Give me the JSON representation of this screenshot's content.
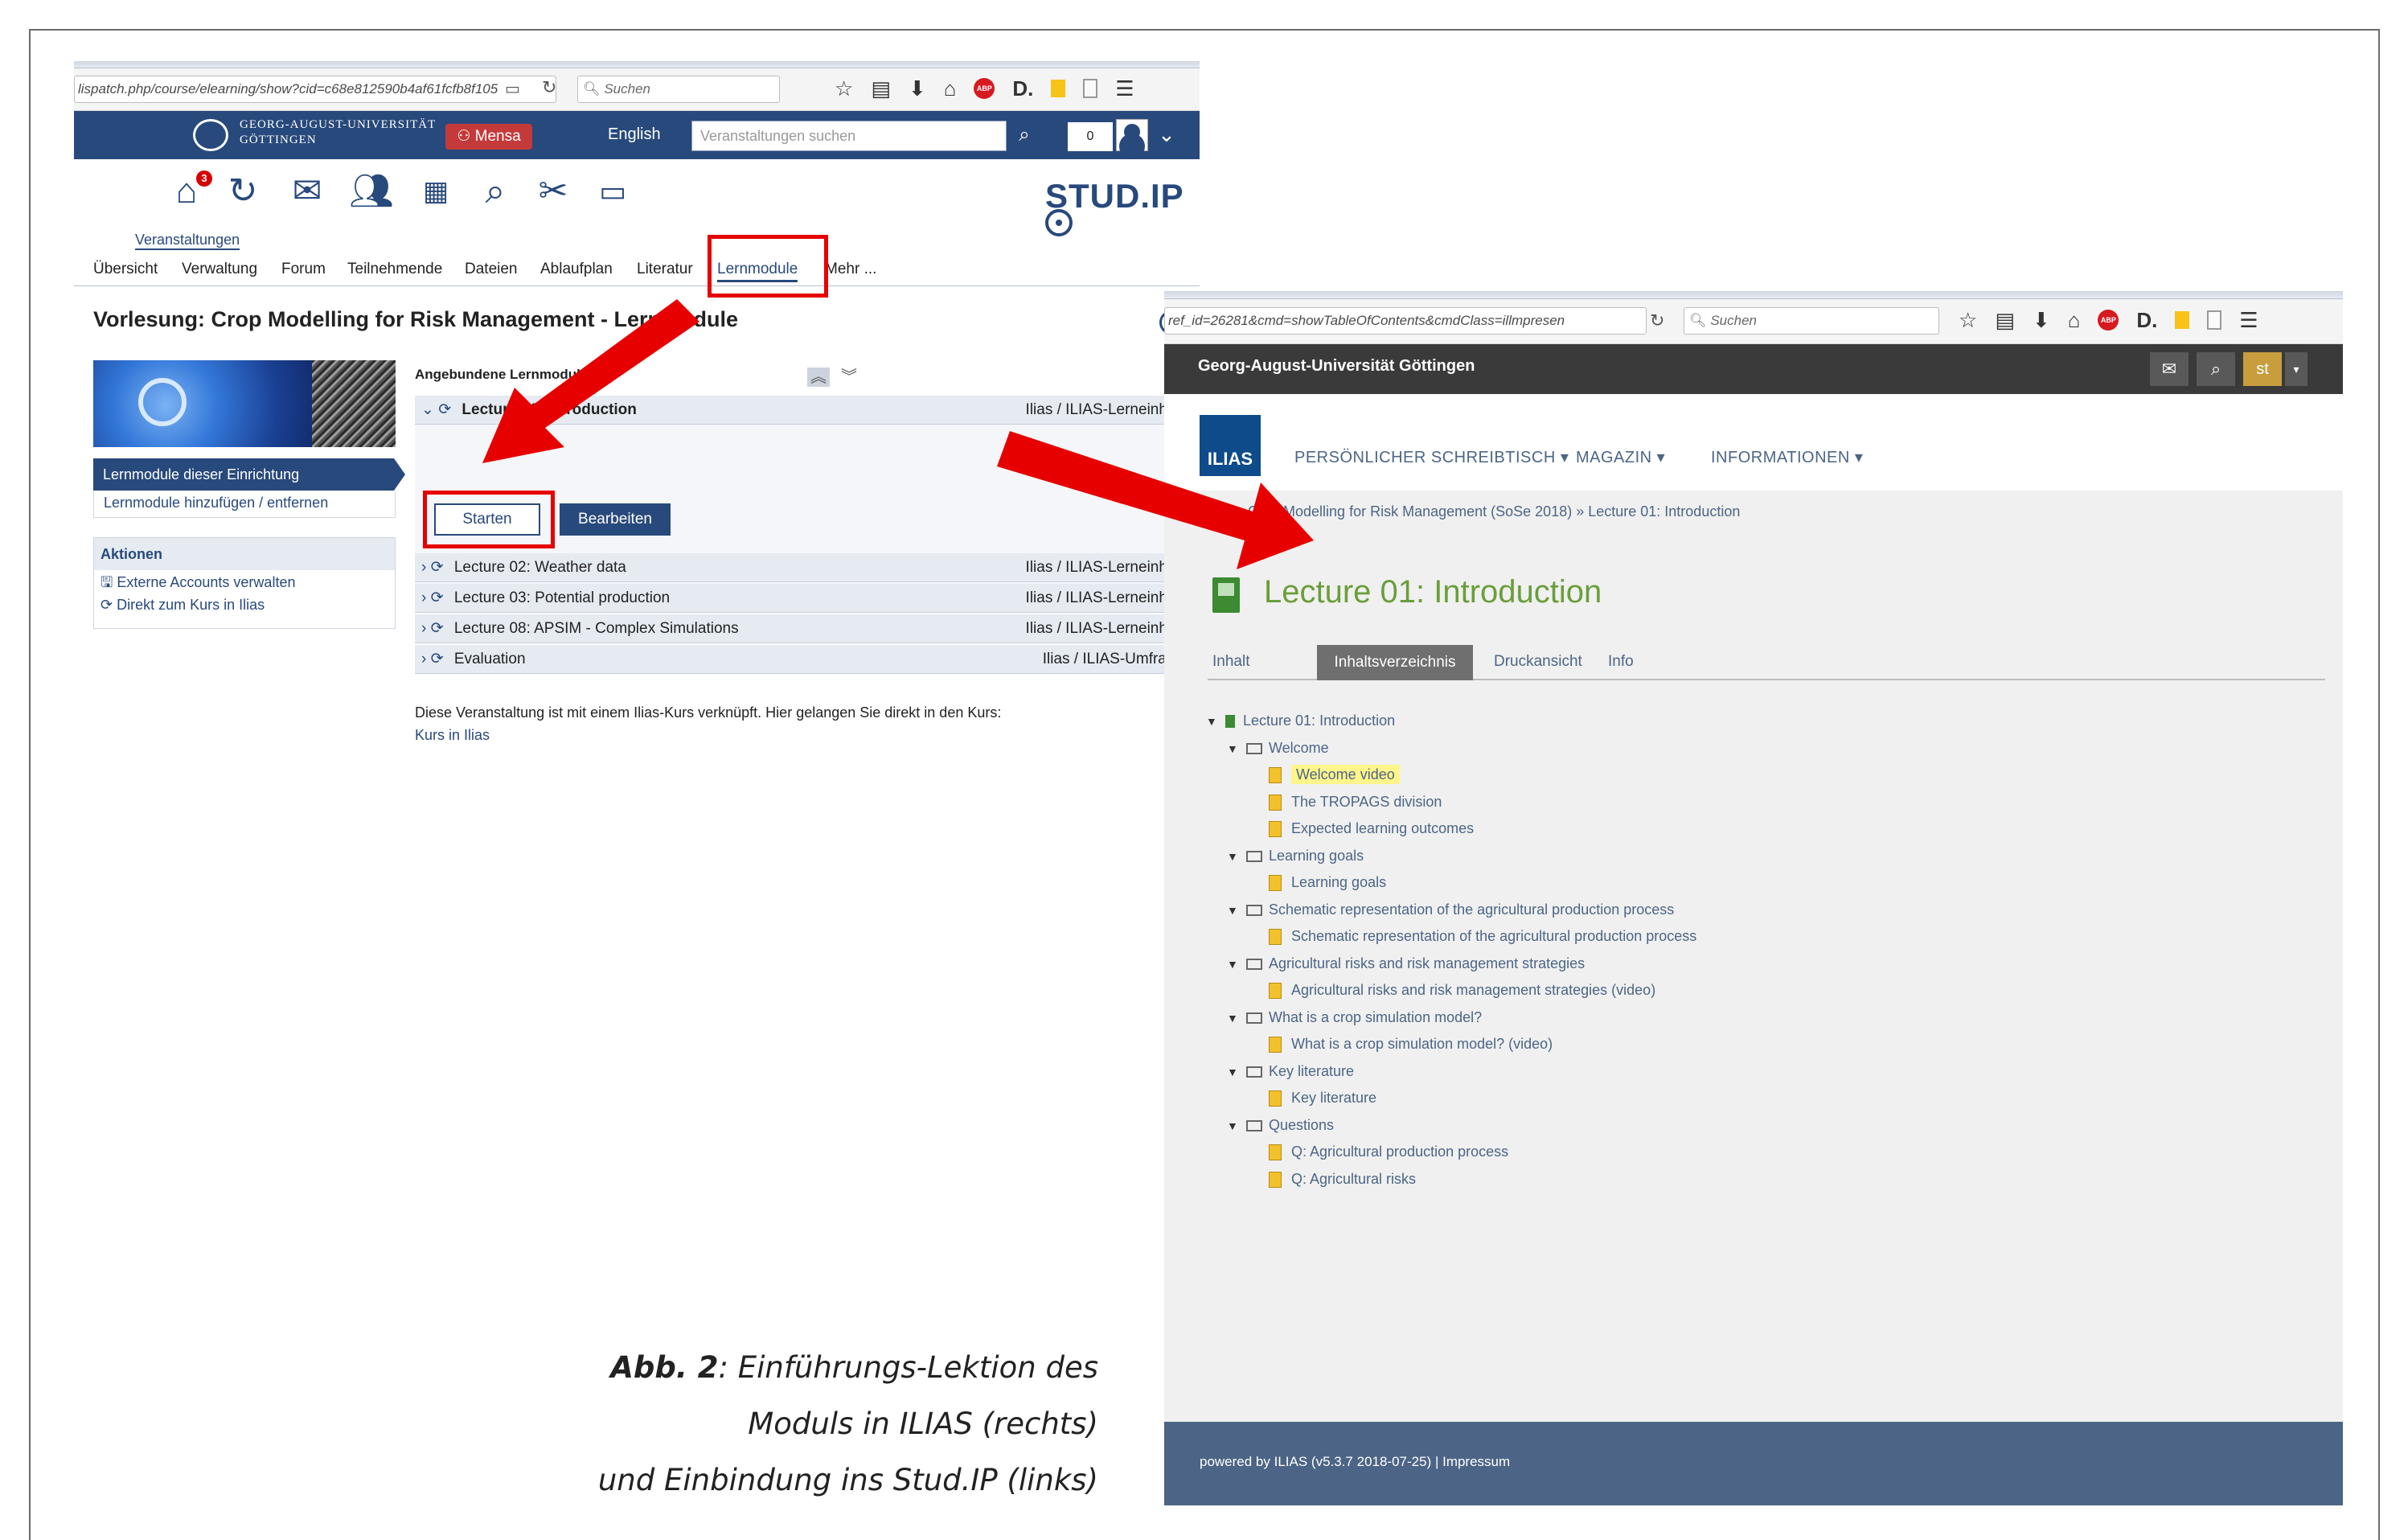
{
  "studip": {
    "browser": {
      "url": "lispatch.php/course/elearning/show?cid=c68e812590b4af61fcfb8f105",
      "search_placeholder": "Suchen"
    },
    "header": {
      "university": [
        "GEORG-AUGUST-UNIVERSITÄT",
        "GÖTTINGEN"
      ],
      "mensa_label": "Mensa",
      "language": "English",
      "search_placeholder": "Veranstaltungen suchen",
      "count": "0"
    },
    "nav": {
      "home_badge": "3",
      "active_label": "Veranstaltungen",
      "logo_text": "STUD.IP",
      "tabs": [
        "Übersicht",
        "Verwaltung",
        "Forum",
        "Teilnehmende",
        "Dateien",
        "Ablaufplan",
        "Literatur",
        "Lernmodule",
        "Mehr ..."
      ]
    },
    "page_title": "Vorlesung: Crop Modelling for Risk Management - Lernmodule",
    "sidebar": {
      "active_item": "Lernmodule dieser Einrichtung",
      "item": "Lernmodule hinzufügen / entfernen",
      "actions_heading": "Aktionen",
      "actions": [
        "Externe Accounts verwalten",
        "Direkt zum Kurs in Ilias"
      ]
    },
    "modules": {
      "heading": "Angebundene Lernmodule",
      "open_title": "Lecture 01: Introduction",
      "open_type": "Ilias / ILIAS-Lerneinheit",
      "start_label": "Starten",
      "edit_label": "Bearbeiten",
      "rows": [
        {
          "title": "Lecture 02: Weather data",
          "type": "Ilias / ILIAS-Lerneinheit"
        },
        {
          "title": "Lecture 03: Potential production",
          "type": "Ilias / ILIAS-Lerneinheit"
        },
        {
          "title": "Lecture 08: APSIM - Complex Simulations",
          "type": "Ilias / ILIAS-Lerneinheit"
        },
        {
          "title": "Evaluation",
          "type": "Ilias / ILIAS-Umfrage"
        }
      ],
      "note": "Diese Veranstaltung ist mit einem Ilias-Kurs verknüpft. Hier gelangen Sie direkt in den Kurs:",
      "note_link": "Kurs in Ilias"
    }
  },
  "ilias": {
    "browser": {
      "url": "ref_id=26281&cmd=showTableOfContents&cmdClass=illmpresen",
      "search_placeholder": "Suchen"
    },
    "top_title": "Georg-August-Universität Göttingen",
    "user_initials": "st",
    "logo": "ILIAS",
    "menu": [
      "PERSÖNLICHER SCHREIBTISCH ▾",
      "MAGAZIN ▾",
      "INFORMATIONEN ▾"
    ],
    "breadcrumb": "P-Kurs Crop Modelling for Risk Management (SoSe 2018)  »  Lecture 01: Introduction",
    "title": "Lecture 01: Introduction",
    "tabs": [
      "Inhalt",
      "Inhaltsverzeichnis",
      "Druckansicht",
      "Info"
    ],
    "toc": [
      {
        "text": "Lecture 01: Introduction",
        "kind": "book"
      },
      {
        "text": "Welcome",
        "kind": "folder"
      },
      {
        "text": "Welcome video",
        "kind": "page-highlight"
      },
      {
        "text": "The TROPAGS division",
        "kind": "page"
      },
      {
        "text": "Expected learning outcomes",
        "kind": "page"
      },
      {
        "text": "Learning goals",
        "kind": "folder"
      },
      {
        "text": "Learning goals",
        "kind": "page"
      },
      {
        "text": "Schematic representation of the agricultural production process",
        "kind": "folder"
      },
      {
        "text": "Schematic representation of the agricultural production process",
        "kind": "page"
      },
      {
        "text": "Agricultural risks and risk management strategies",
        "kind": "folder"
      },
      {
        "text": "Agricultural risks and risk management strategies (video)",
        "kind": "page"
      },
      {
        "text": "What is a crop simulation model?",
        "kind": "folder"
      },
      {
        "text": "What is a crop simulation model? (video)",
        "kind": "page"
      },
      {
        "text": "Key literature",
        "kind": "folder"
      },
      {
        "text": "Key literature",
        "kind": "page"
      },
      {
        "text": "Questions",
        "kind": "folder"
      },
      {
        "text": "Q: Agricultural production process",
        "kind": "page"
      },
      {
        "text": "Q: Agricultural risks",
        "kind": "page"
      }
    ],
    "footer": "powered by ILIAS (v5.3.7 2018-07-25) | Impressum"
  },
  "caption": {
    "label": "Abb. 2",
    "text1": ": Einführungs-Lektion des",
    "text2": "Moduls in ILIAS (rechts)",
    "text3": "und Einbindung ins Stud.IP (links)"
  },
  "colors": {
    "studip_blue": "#28497c",
    "highlight_red": "#e60000",
    "ilias_green": "#6a9e3a",
    "ilias_footer": "#4c6586"
  }
}
